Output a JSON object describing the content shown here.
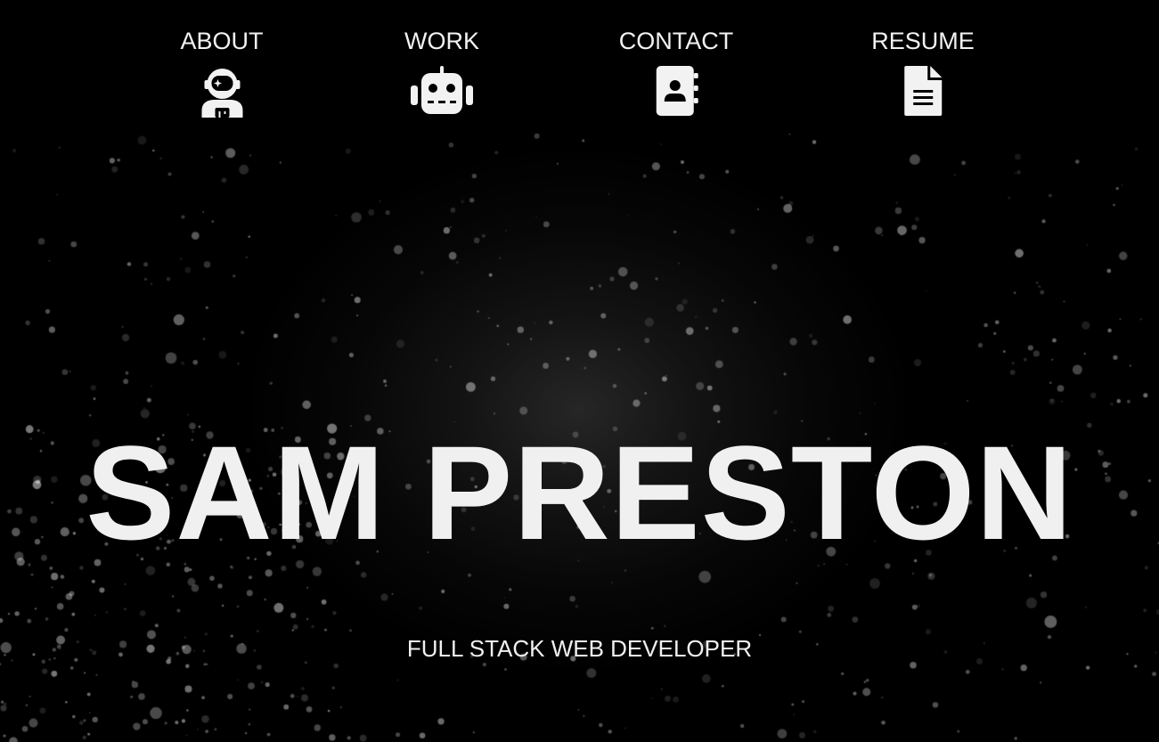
{
  "nav": {
    "items": [
      {
        "label": "ABOUT",
        "icon": "astronaut-icon"
      },
      {
        "label": "WORK",
        "icon": "robot-icon"
      },
      {
        "label": "CONTACT",
        "icon": "address-book-icon"
      },
      {
        "label": "RESUME",
        "icon": "document-icon"
      }
    ]
  },
  "hero": {
    "name": "SAM PRESTON",
    "subtitle": "FULL STACK WEB DEVELOPER"
  },
  "colors": {
    "background": "#000000",
    "text": "#f0f0f0",
    "particle": "#ffffff"
  }
}
